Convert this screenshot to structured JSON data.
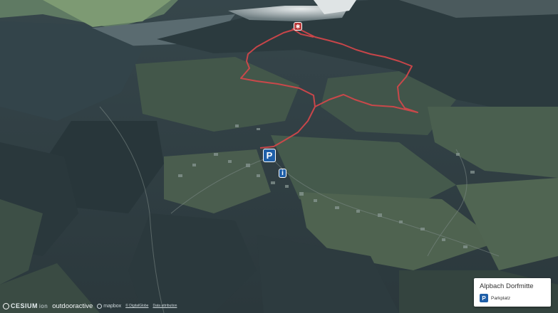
{
  "map": {
    "route_color": "#d8474a",
    "marker_color": "#1f5fa8",
    "poi_color": "#b83a3a",
    "terrain_style": "3D terrain, satellite imagery"
  },
  "markers": {
    "parking_glyph": "P",
    "info_glyph": "i",
    "poi_glyph": "✱"
  },
  "attribution": {
    "cesium": "CESIUM",
    "cesium_ion": "ion",
    "outdooractive": "outdooractive",
    "mapbox": "mapbox",
    "credit_1": "© DigitalGlobe",
    "credit_2": "Data attribution"
  },
  "legend": {
    "title": "Alpbach Dorfmitte",
    "item_icon": "P",
    "item_label": "Parkplatz"
  }
}
